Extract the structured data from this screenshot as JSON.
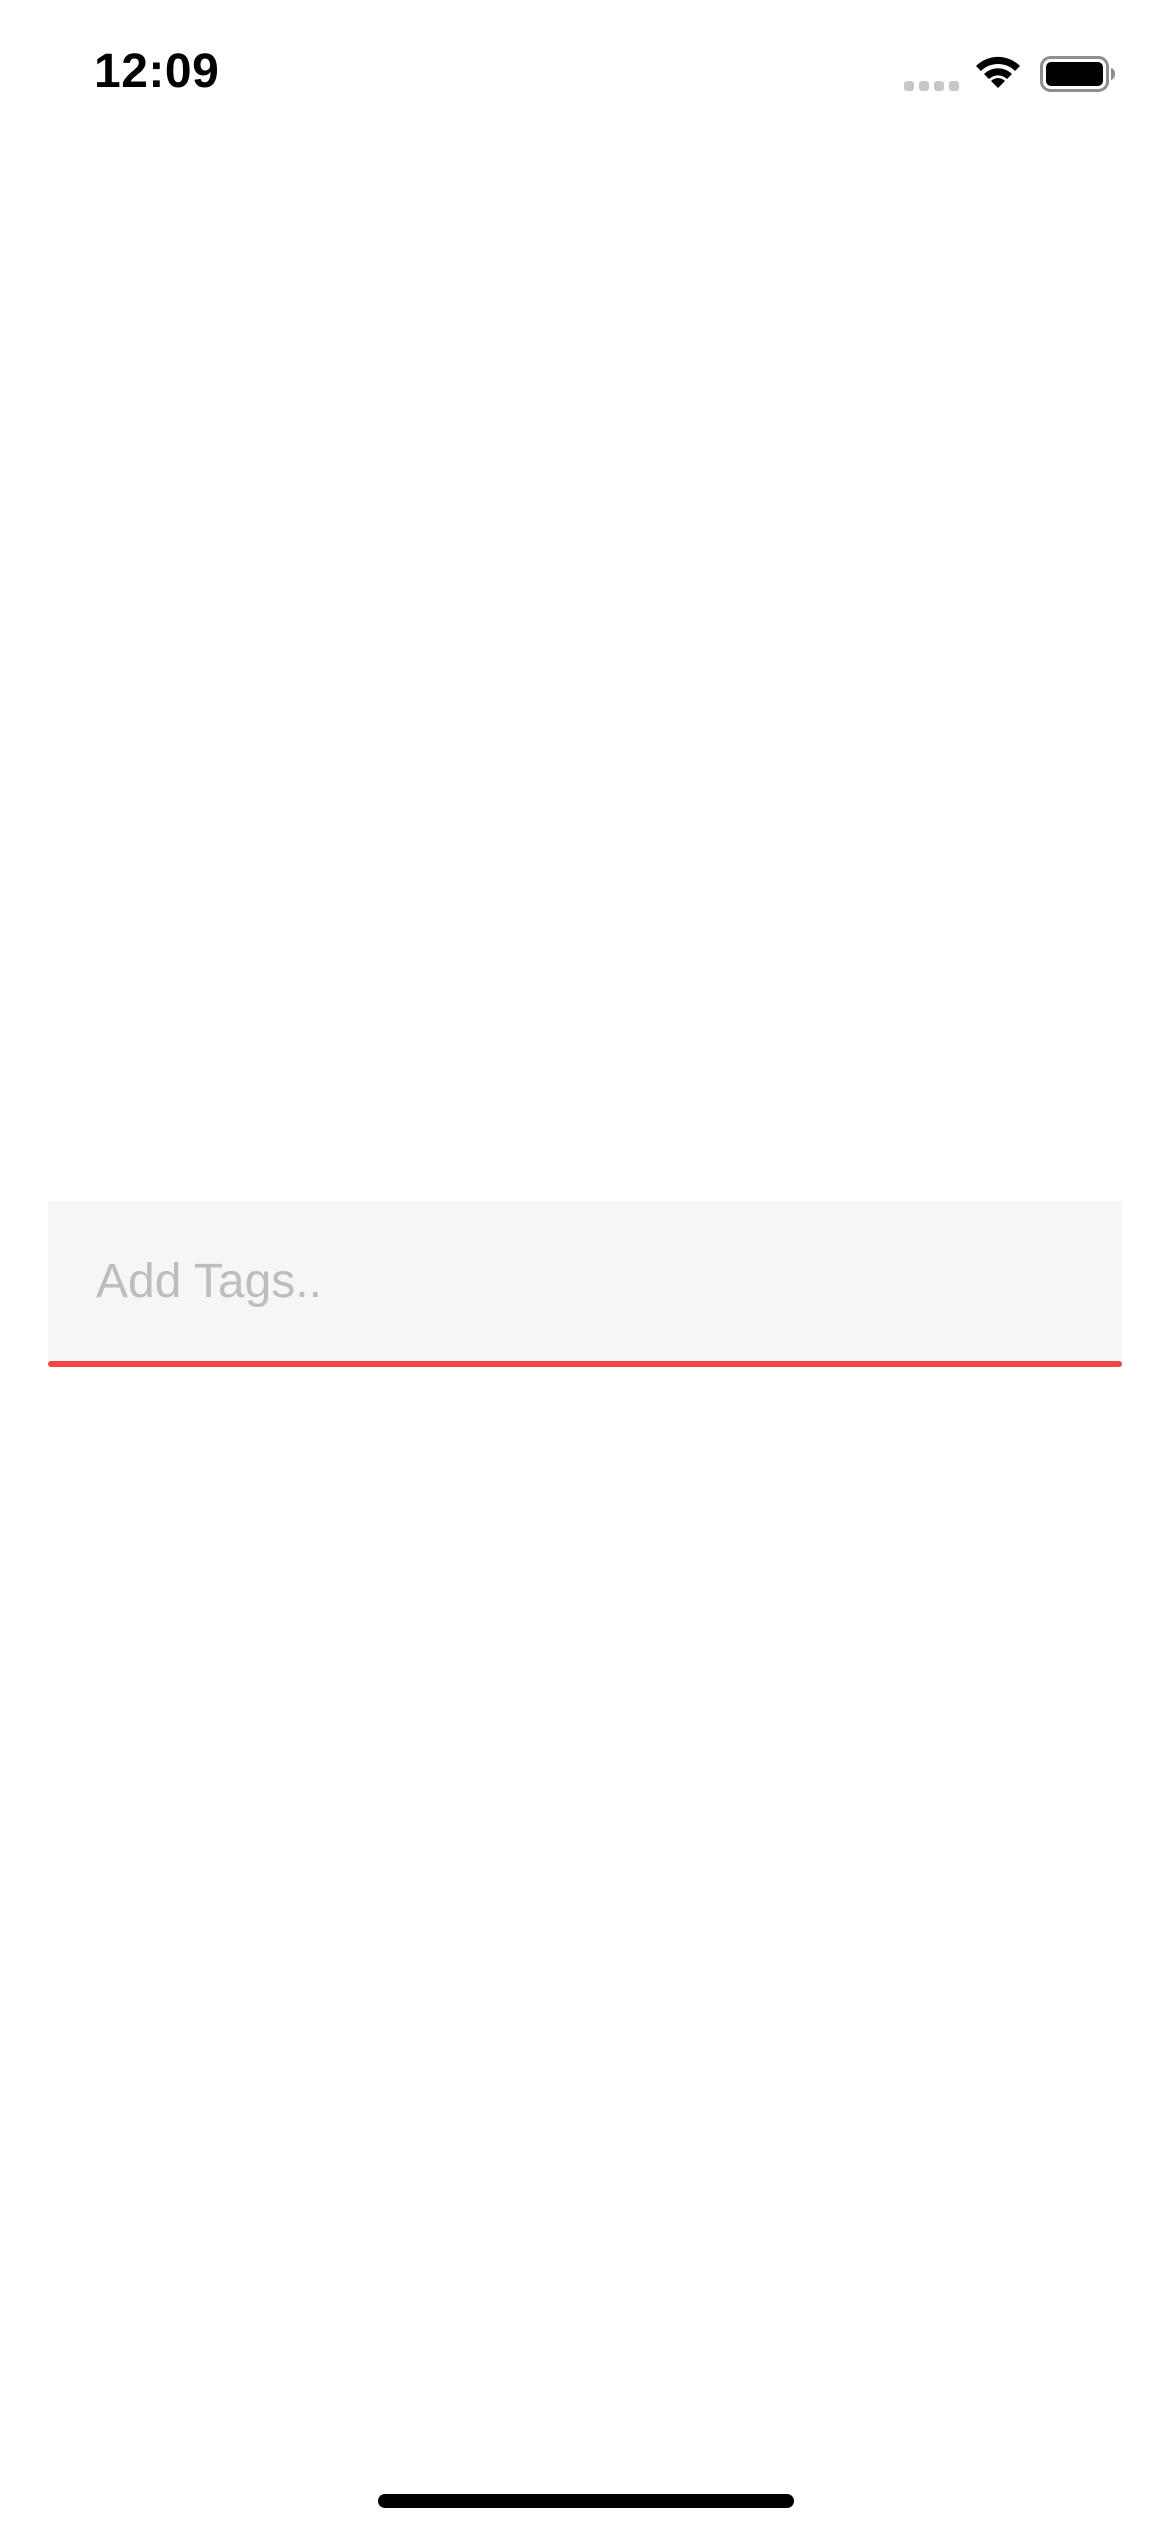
{
  "status_bar": {
    "time": "12:09",
    "icons": [
      "cellular-signal-icon",
      "wifi-icon",
      "battery-icon"
    ]
  },
  "tag_input": {
    "placeholder": "Add Tags..",
    "value": "",
    "background_color": "#f6f6f6",
    "underline_color": "#f04646"
  },
  "home_indicator": {
    "color": "#000000"
  }
}
